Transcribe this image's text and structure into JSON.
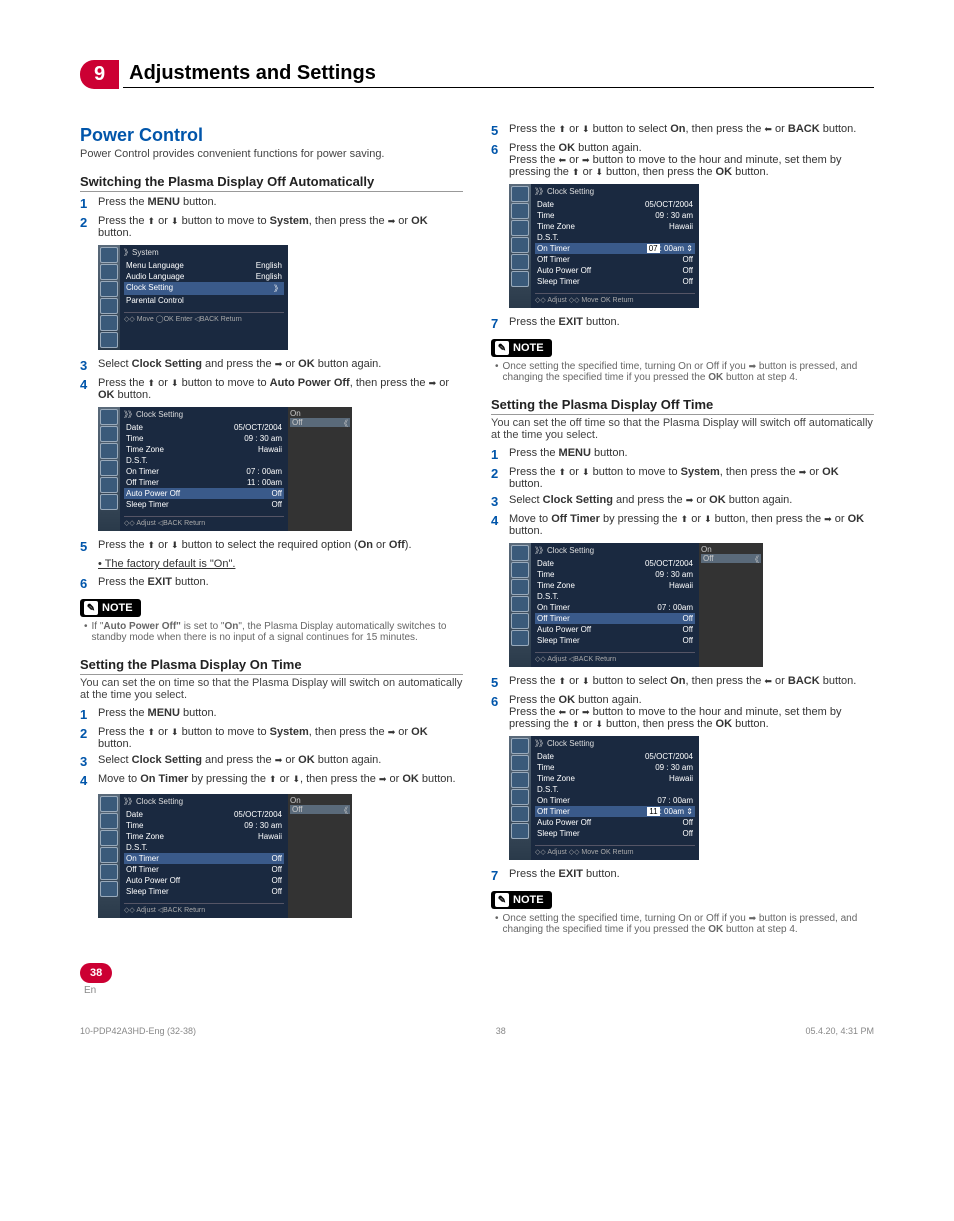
{
  "chapter": {
    "num": "9",
    "title": "Adjustments and Settings"
  },
  "section": {
    "title": "Power Control",
    "intro": "Power Control provides convenient functions for power saving."
  },
  "sub1": {
    "title": "Switching the Plasma Display Off Automatically",
    "s1": "Press the ",
    "s1b": "MENU",
    "s1e": " button.",
    "s2a": "Press the ",
    "s2b": " or ",
    "s2c": " button to move to ",
    "s2d": "System",
    "s2e": ", then press the ",
    "s2f": " or ",
    "s2g": "OK",
    "s2h": " button.",
    "s3a": "Select ",
    "s3b": "Clock Setting",
    "s3c": " and press the ",
    "s3d": " or ",
    "s3e": "OK",
    "s3f": " button again.",
    "s4a": "Press the ",
    "s4b": " or ",
    "s4c": " button to move to ",
    "s4d": "Auto Power Off",
    "s4e": ", then press the ",
    "s4f": " or ",
    "s4g": "OK",
    "s4h": " button.",
    "s5a": "Press the ",
    "s5b": " or ",
    "s5c": " button to select the required option (",
    "s5d": "On",
    "s5e": " or ",
    "s5f": "Off",
    "s5g": ").",
    "s5sub": "• The factory default is \"On\".",
    "s6a": "Press the ",
    "s6b": "EXIT",
    "s6c": " button.",
    "note": "If \"",
    "noteb": "Auto Power Off\"",
    "notec": " is set to \"",
    "noted": "On",
    "notee": "\", the Plasma Display automatically switches to standby mode when there is no input of a signal continues for 15 minutes."
  },
  "osd_system": {
    "title": "》System",
    "menu_lang": "Menu Language",
    "menu_lang_v": "English",
    "audio_lang": "Audio Language",
    "audio_lang_v": "English",
    "clock": "Clock Setting",
    "clock_v": "》",
    "parental": "Parental Control",
    "footer": "◇◇ Move    ◯OK Enter    ◁BACK Return"
  },
  "osd_clock": {
    "title": "》》Clock Setting",
    "date": "Date",
    "date_v": "05/OCT/2004",
    "time": "Time",
    "time_v": "09 : 30 am",
    "tz": "Time Zone",
    "tz_v": "Hawaii",
    "dst": "D.S.T.",
    "on_timer": "On Timer",
    "on_timer_v": "07 : 00am",
    "off_timer": "Off Timer",
    "off_timer_v": "11 : 00am",
    "apo": "Auto Power Off",
    "apo_v": "Off",
    "sleep": "Sleep Timer",
    "sleep_v": "Off",
    "footer_adjust": "◇◇ Adjust              ◁BACK Return",
    "footer_full": "◇◇ Adjust  ◇◇ Move     OK Return",
    "opt_on": "On",
    "opt_off": "Off"
  },
  "sub2": {
    "title": "Setting the Plasma Display On Time",
    "intro": "You can set the on time so that the Plasma Display will switch on automatically at the time you select.",
    "s1": "Press the ",
    "s1b": "MENU",
    "s1e": " button.",
    "s3a": "Select ",
    "s3b": "Clock Setting",
    "s3c": " and press the ",
    "s3d": " or ",
    "s3e": "OK",
    "s3f": " button again.",
    "s4a": "Move to ",
    "s4b": "On Timer",
    "s4c": " by pressing the ",
    "s4d": " or ",
    "s4e": ", then press the ",
    "s4f": " or ",
    "s4g": "OK",
    "s4h": " button.",
    "s5a": "Press the ",
    "s5b": " or ",
    "s5c": " button to select ",
    "s5d": "On",
    "s5e": ", then press the ",
    "s5f": " or ",
    "s5g": "BACK",
    "s5h": " button.",
    "s6a": "Press the ",
    "s6b": "OK",
    "s6c": " button again.",
    "s6d": "Press the ",
    "s6e": " or ",
    "s6f": " button to move to the hour and minute, set them by pressing the ",
    "s6g": " or ",
    "s6h": " button, then press the ",
    "s6i": "OK",
    "s6j": " button.",
    "s7a": "Press the ",
    "s7b": "EXIT",
    "s7c": " button.",
    "edit_val": "07",
    "edit_suffix": ": 00am ⇕"
  },
  "sub3": {
    "title": "Setting the Plasma Display Off Time",
    "intro": "You can set the off time so that the Plasma Display will switch off automatically at the time you select.",
    "s4a": "Move to ",
    "s4b": "Off Timer",
    "s4c": " by pressing the ",
    "s4d": " or ",
    "s4e": " button, then press the ",
    "s4f": " or ",
    "s4g": "OK",
    "s4h": " button.",
    "edit_val": "11",
    "edit_suffix": ": 00am ⇕"
  },
  "note2": {
    "a": "Once setting the specified time, turning On or Off if you ",
    "b": " button is pressed, and changing the specified time if you pressed the ",
    "c": "OK",
    "d": " button at step 4."
  },
  "labels": {
    "note": "NOTE"
  },
  "page": {
    "num": "38",
    "lang": "En"
  },
  "footer": {
    "left": "10-PDP42A3HD-Eng (32-38)",
    "mid": "38",
    "right": "05.4.20, 4:31 PM"
  }
}
